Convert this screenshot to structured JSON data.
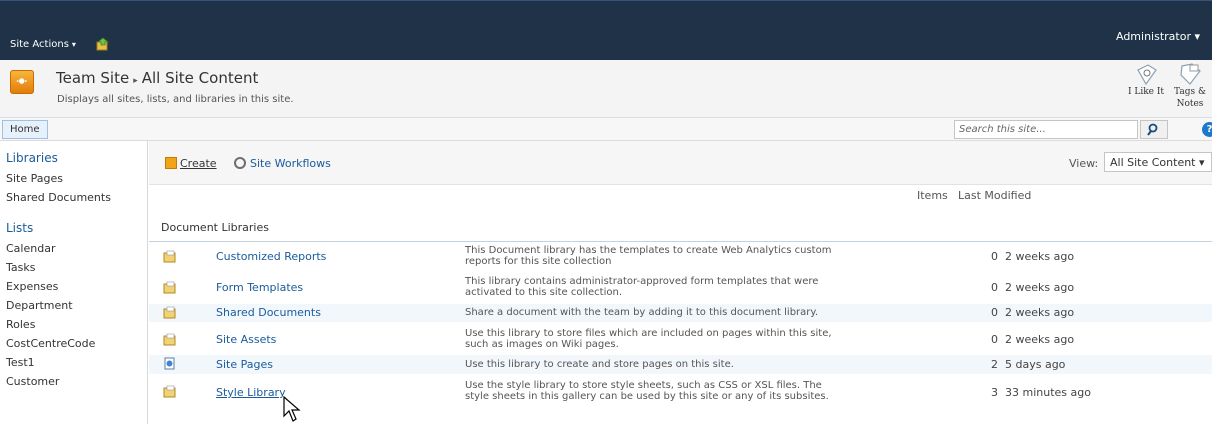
{
  "topbar": {
    "site_actions": "Site Actions",
    "caret": "▾",
    "admin": "Administrator ▾"
  },
  "header": {
    "site_name": "Team Site",
    "separator": "▸",
    "page_name": "All Site Content",
    "description": "Displays all sites, lists, and libraries in this site.",
    "like_label": "I Like It",
    "tags_label_1": "Tags &",
    "tags_label_2": "Notes"
  },
  "nav": {
    "home": "Home",
    "search_placeholder": "Search this site...",
    "help": "?"
  },
  "leftnav": {
    "libraries_heading": "Libraries",
    "libraries": [
      "Site Pages",
      "Shared Documents"
    ],
    "lists_heading": "Lists",
    "lists": [
      "Calendar",
      "Tasks",
      "Expenses",
      "Department",
      "Roles",
      "CostCentreCode",
      "Test1",
      "Customer"
    ]
  },
  "toolbar": {
    "create": "Create",
    "site_workflows": "Site Workflows",
    "view_label": "View:",
    "view_value": "All Site Content ▾"
  },
  "columns": {
    "items": "Items",
    "last_modified": "Last Modified"
  },
  "section_title": "Document Libraries",
  "rows": [
    {
      "name": "Customized Reports",
      "desc1": "This Document library has the templates to create Web Analytics custom",
      "desc2": "reports for this site collection",
      "count": "0",
      "modified": "2 weeks ago",
      "icon": "folder-icon"
    },
    {
      "name": "Form Templates",
      "desc1": "This library contains administrator-approved form templates that were",
      "desc2": "activated to this site collection.",
      "count": "0",
      "modified": "2 weeks ago",
      "icon": "folder-icon"
    },
    {
      "name": "Shared Documents",
      "desc1": "Share a document with the team by adding it to this document library.",
      "desc2": "",
      "count": "0",
      "modified": "2 weeks ago",
      "icon": "folder-icon"
    },
    {
      "name": "Site Assets",
      "desc1": "Use this library to store files which are included on pages within this site,",
      "desc2": "such as images on Wiki pages.",
      "count": "0",
      "modified": "2 weeks ago",
      "icon": "folder-icon"
    },
    {
      "name": "Site Pages",
      "desc1": "Use this library to create and store pages on this site.",
      "desc2": "",
      "count": "2",
      "modified": "5 days ago",
      "icon": "page-icon"
    },
    {
      "name": "Style Library",
      "desc1": "Use the style library to store style sheets, such as CSS or XSL files. The",
      "desc2": "style sheets in this gallery can be used by this site or any of its subsites.",
      "count": "3",
      "modified": "33 minutes ago",
      "icon": "folder-icon"
    }
  ],
  "colors": {
    "topbar": "#1f3248",
    "link": "#1a5b9b",
    "alt_row": "#f2f7fc"
  }
}
